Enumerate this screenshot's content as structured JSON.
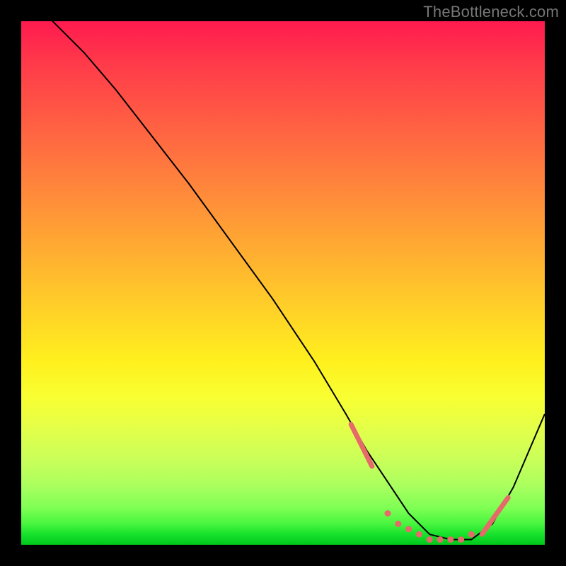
{
  "watermark": "TheBottleneck.com",
  "chart_data": {
    "type": "line",
    "title": "",
    "xlabel": "",
    "ylabel": "",
    "xlim": [
      0,
      100
    ],
    "ylim": [
      0,
      100
    ],
    "grid": false,
    "curve": {
      "x": [
        0,
        4,
        8,
        12,
        18,
        25,
        32,
        40,
        48,
        56,
        62,
        66,
        70,
        74,
        78,
        82,
        86,
        90,
        94,
        100
      ],
      "y": [
        106,
        102,
        98,
        94,
        87,
        78,
        69,
        58,
        47,
        35,
        25,
        18,
        12,
        6,
        2,
        1,
        1,
        4,
        11,
        25
      ]
    },
    "marker_segments": [
      {
        "x0": 63,
        "y0": 23,
        "x1": 67,
        "y1": 15
      },
      {
        "x0": 88,
        "y0": 2,
        "x1": 93,
        "y1": 9
      }
    ],
    "marker_points": {
      "x": [
        70,
        72,
        74,
        76,
        78,
        80,
        82,
        84,
        86
      ],
      "y": [
        6,
        4,
        3,
        2,
        1,
        1,
        1,
        1,
        2
      ]
    },
    "colors": {
      "curve": "#000000",
      "markers": "#e66a6a"
    }
  }
}
